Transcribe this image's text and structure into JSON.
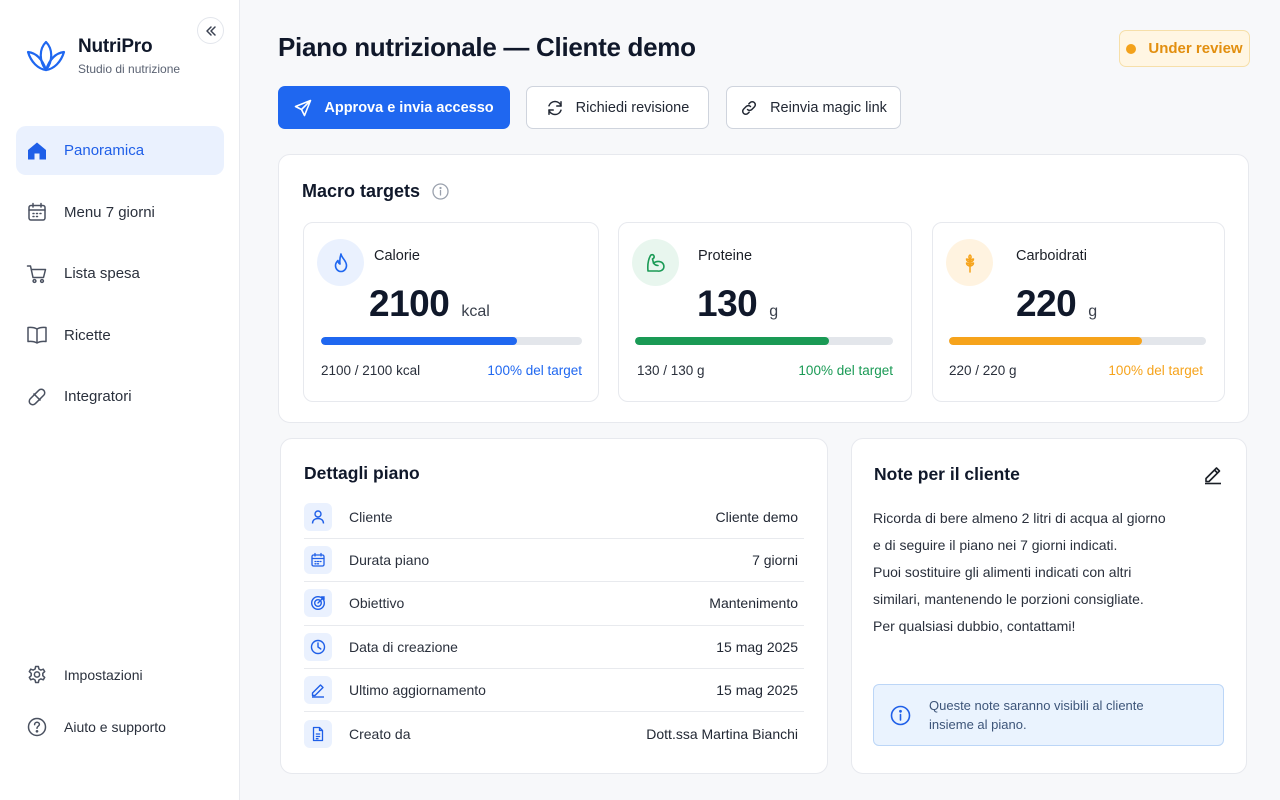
{
  "brand": {
    "name": "NutriPro",
    "subtitle": "Studio di nutrizione"
  },
  "sidebar": {
    "items": [
      {
        "label": "Panoramica",
        "icon": "home-icon",
        "active": true
      },
      {
        "label": "Menu 7 giorni",
        "icon": "calendar-icon"
      },
      {
        "label": "Lista spesa",
        "icon": "cart-icon"
      },
      {
        "label": "Ricette",
        "icon": "book-icon"
      },
      {
        "label": "Integratori",
        "icon": "pill-icon"
      }
    ],
    "bottom": [
      {
        "label": "Impostazioni",
        "icon": "gear-icon"
      },
      {
        "label": "Aiuto e supporto",
        "icon": "help-icon"
      }
    ]
  },
  "header": {
    "title": "Piano nutrizionale — Cliente demo",
    "status": "Under review"
  },
  "actions": {
    "approve": "Approva e invia accesso",
    "revision": "Richiedi revisione",
    "magic_link": "Reinvia magic link"
  },
  "macros": {
    "title": "Macro targets",
    "items": [
      {
        "label": "Calorie",
        "value": "2100",
        "unit": "kcal",
        "progress": 0.75,
        "summary": "2100 / 2100 kcal",
        "percent": "100% del target",
        "color": "#1f67f0",
        "icon_bg": "#eaf1fe",
        "icon": "flame-icon"
      },
      {
        "label": "Proteine",
        "value": "130",
        "unit": "g",
        "progress": 0.75,
        "summary": "130 / 130 g",
        "percent": "100% del target",
        "color": "#1a9a55",
        "icon_bg": "#e8f6ee",
        "icon": "muscle-icon"
      },
      {
        "label": "Carboidrati",
        "value": "220",
        "unit": "g",
        "progress": 0.75,
        "summary": "220 / 220 g",
        "percent": "100% del target",
        "color": "#f6a31b",
        "icon_bg": "#fff3e0",
        "icon": "wheat-icon"
      }
    ]
  },
  "details": {
    "title": "Dettagli piano",
    "rows": [
      {
        "label": "Cliente",
        "value": "Cliente demo",
        "icon": "user-icon"
      },
      {
        "label": "Durata piano",
        "value": "7 giorni",
        "icon": "calendar-icon"
      },
      {
        "label": "Obiettivo",
        "value": "Mantenimento",
        "icon": "target-icon"
      },
      {
        "label": "Data di creazione",
        "value": "15 mag 2025",
        "icon": "clock-icon"
      },
      {
        "label": "Ultimo aggiornamento",
        "value": "15 mag 2025",
        "icon": "pencil-icon"
      },
      {
        "label": "Creato da",
        "value": "Dott.ssa Martina Bianchi",
        "icon": "document-icon"
      }
    ]
  },
  "notes": {
    "title": "Note per il cliente",
    "lines": [
      "Ricorda di bere almeno 2 litri di acqua al giorno",
      "e di seguire il piano nei 7 giorni indicati.",
      "Puoi sostituire gli alimenti indicati con altri",
      "similari, mantenendo le porzioni consigliate.",
      "Per qualsiasi dubbio, contattami!"
    ],
    "hint": "Queste note saranno visibili al cliente insieme al piano."
  }
}
